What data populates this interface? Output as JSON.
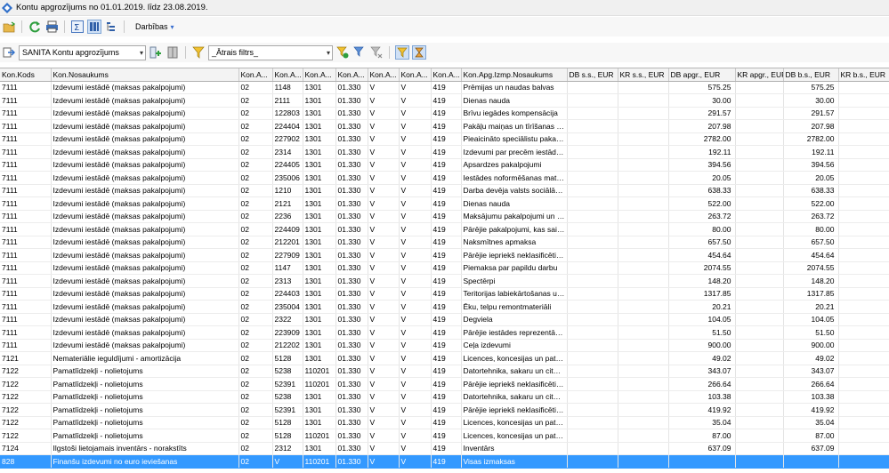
{
  "window": {
    "title": "Kontu apgrozījums no 01.01.2019. līdz 23.08.2019."
  },
  "toolbar1": {
    "actions_label": "Darbības"
  },
  "toolbar2": {
    "account_combo": "SANITA Kontu apgrozījums",
    "filter_combo": "_Ātrais filtrs_"
  },
  "grid": {
    "columns": [
      "Kon.Kods",
      "Kon.Nosaukums",
      "Kon.A...",
      "Kon.A...",
      "Kon.A...",
      "Kon.A...",
      "Kon.A...",
      "Kon.A...",
      "Kon.A...",
      "Kon.Apg.Izmp.Nosaukums",
      "DB s.s., EUR",
      "KR s.s., EUR",
      "DB apgr., EUR",
      "KR apgr., EUR",
      "DB b.s., EUR",
      "KR b.s., EUR"
    ],
    "rows": [
      [
        "7111",
        "Izdevumi iestādē (maksas pakalpojumi)",
        "02",
        "1148",
        "1301",
        "01.330",
        "V",
        "V",
        "419",
        "Prēmijas un naudas balvas",
        "",
        "",
        "575.25",
        "",
        "575.25",
        ""
      ],
      [
        "7111",
        "Izdevumi iestādē (maksas pakalpojumi)",
        "02",
        "2111",
        "1301",
        "01.330",
        "V",
        "V",
        "419",
        "Dienas nauda",
        "",
        "",
        "30.00",
        "",
        "30.00",
        ""
      ],
      [
        "7111",
        "Izdevumi iestādē (maksas pakalpojumi)",
        "02",
        "122803",
        "1301",
        "01.330",
        "V",
        "V",
        "419",
        "Brīvu iegādes kompensācija",
        "",
        "",
        "291.57",
        "",
        "291.57",
        ""
      ],
      [
        "7111",
        "Izdevumi iestādē (maksas pakalpojumi)",
        "02",
        "224404",
        "1301",
        "01.330",
        "V",
        "V",
        "419",
        "Pakāļu maiņas un tīrīšanas izm...",
        "",
        "",
        "207.98",
        "",
        "207.98",
        ""
      ],
      [
        "7111",
        "Izdevumi iestādē (maksas pakalpojumi)",
        "02",
        "227902",
        "1301",
        "01.330",
        "V",
        "V",
        "419",
        "Pieaicināto speciālistu pakalpoj...",
        "",
        "",
        "2782.00",
        "",
        "2782.00",
        ""
      ],
      [
        "7111",
        "Izdevumi iestādē (maksas pakalpojumi)",
        "02",
        "2314",
        "1301",
        "01.330",
        "V",
        "V",
        "419",
        "Izdevumi par precēm iestādes ...",
        "",
        "",
        "192.11",
        "",
        "192.11",
        ""
      ],
      [
        "7111",
        "Izdevumi iestādē (maksas pakalpojumi)",
        "02",
        "224405",
        "1301",
        "01.330",
        "V",
        "V",
        "419",
        "Apsardzes pakalpojumi",
        "",
        "",
        "394.56",
        "",
        "394.56",
        ""
      ],
      [
        "7111",
        "Izdevumi iestādē (maksas pakalpojumi)",
        "02",
        "235006",
        "1301",
        "01.330",
        "V",
        "V",
        "419",
        "Iestādes noformēšanas materiāli",
        "",
        "",
        "20.05",
        "",
        "20.05",
        ""
      ],
      [
        "7111",
        "Izdevumi iestādē (maksas pakalpojumi)",
        "02",
        "1210",
        "1301",
        "01.330",
        "V",
        "V",
        "419",
        "Darba devēja valsts sociālās a...",
        "",
        "",
        "638.33",
        "",
        "638.33",
        ""
      ],
      [
        "7111",
        "Izdevumi iestādē (maksas pakalpojumi)",
        "02",
        "2121",
        "1301",
        "01.330",
        "V",
        "V",
        "419",
        "Dienas nauda",
        "",
        "",
        "522.00",
        "",
        "522.00",
        ""
      ],
      [
        "7111",
        "Izdevumi iestādē (maksas pakalpojumi)",
        "02",
        "2236",
        "1301",
        "01.330",
        "V",
        "V",
        "419",
        "Maksājumu pakalpojumi un kom...",
        "",
        "",
        "263.72",
        "",
        "263.72",
        ""
      ],
      [
        "7111",
        "Izdevumi iestādē (maksas pakalpojumi)",
        "02",
        "224409",
        "1301",
        "01.330",
        "V",
        "V",
        "419",
        "Pārējie pakalpojumi, kas saistīt...",
        "",
        "",
        "80.00",
        "",
        "80.00",
        ""
      ],
      [
        "7111",
        "Izdevumi iestādē (maksas pakalpojumi)",
        "02",
        "212201",
        "1301",
        "01.330",
        "V",
        "V",
        "419",
        "Naksmītnes apmaksa",
        "",
        "",
        "657.50",
        "",
        "657.50",
        ""
      ],
      [
        "7111",
        "Izdevumi iestādē (maksas pakalpojumi)",
        "02",
        "227909",
        "1301",
        "01.330",
        "V",
        "V",
        "419",
        "Pārējie iepriekš neklasificētie p...",
        "",
        "",
        "454.64",
        "",
        "454.64",
        ""
      ],
      [
        "7111",
        "Izdevumi iestādē (maksas pakalpojumi)",
        "02",
        "1147",
        "1301",
        "01.330",
        "V",
        "V",
        "419",
        "Piemaksa par papildu darbu",
        "",
        "",
        "2074.55",
        "",
        "2074.55",
        ""
      ],
      [
        "7111",
        "Izdevumi iestādē (maksas pakalpojumi)",
        "02",
        "2313",
        "1301",
        "01.330",
        "V",
        "V",
        "419",
        "Spectērpi",
        "",
        "",
        "148.20",
        "",
        "148.20",
        ""
      ],
      [
        "7111",
        "Izdevumi iestādē (maksas pakalpojumi)",
        "02",
        "224403",
        "1301",
        "01.330",
        "V",
        "V",
        "419",
        "Teritorijas labiekārtošanas un ...",
        "",
        "",
        "1317.85",
        "",
        "1317.85",
        ""
      ],
      [
        "7111",
        "Izdevumi iestādē (maksas pakalpojumi)",
        "02",
        "235004",
        "1301",
        "01.330",
        "V",
        "V",
        "419",
        "Ēku, telpu remontmateriāli",
        "",
        "",
        "20.21",
        "",
        "20.21",
        ""
      ],
      [
        "7111",
        "Izdevumi iestādē (maksas pakalpojumi)",
        "02",
        "2322",
        "1301",
        "01.330",
        "V",
        "V",
        "419",
        "Degviela",
        "",
        "",
        "104.05",
        "",
        "104.05",
        ""
      ],
      [
        "7111",
        "Izdevumi iestādē (maksas pakalpojumi)",
        "02",
        "223909",
        "1301",
        "01.330",
        "V",
        "V",
        "419",
        "Pārējie iestādes reprezentācija...",
        "",
        "",
        "51.50",
        "",
        "51.50",
        ""
      ],
      [
        "7111",
        "Izdevumi iestādē (maksas pakalpojumi)",
        "02",
        "212202",
        "1301",
        "01.330",
        "V",
        "V",
        "419",
        "Ceļa izdevumi",
        "",
        "",
        "900.00",
        "",
        "900.00",
        ""
      ],
      [
        "7121",
        "Nemateriālie ieguldījumi - amortizācija",
        "02",
        "5128",
        "1301",
        "01.330",
        "V",
        "V",
        "419",
        "Licences, koncesijas un patenti...",
        "",
        "",
        "49.02",
        "",
        "49.02",
        ""
      ],
      [
        "7122",
        "Pamatlīdzekļi - nolietojums",
        "02",
        "5238",
        "110201",
        "01.330",
        "V",
        "V",
        "419",
        "Datortehnika, sakaru un cita bi...",
        "",
        "",
        "343.07",
        "",
        "343.07",
        ""
      ],
      [
        "7122",
        "Pamatlīdzekļi - nolietojums",
        "02",
        "52391",
        "110201",
        "01.330",
        "V",
        "V",
        "419",
        "Pārējie iepriekš neklasificētie p...",
        "",
        "",
        "266.64",
        "",
        "266.64",
        ""
      ],
      [
        "7122",
        "Pamatlīdzekļi - nolietojums",
        "02",
        "5238",
        "1301",
        "01.330",
        "V",
        "V",
        "419",
        "Datortehnika, sakaru un cita bi...",
        "",
        "",
        "103.38",
        "",
        "103.38",
        ""
      ],
      [
        "7122",
        "Pamatlīdzekļi - nolietojums",
        "02",
        "52391",
        "1301",
        "01.330",
        "V",
        "V",
        "419",
        "Pārējie iepriekš neklasificētie p...",
        "",
        "",
        "419.92",
        "",
        "419.92",
        ""
      ],
      [
        "7122",
        "Pamatlīdzekļi - nolietojums",
        "02",
        "5128",
        "1301",
        "01.330",
        "V",
        "V",
        "419",
        "Licences, koncesijas un patenti...",
        "",
        "",
        "35.04",
        "",
        "35.04",
        ""
      ],
      [
        "7122",
        "Pamatlīdzekļi - nolietojums",
        "02",
        "5128",
        "110201",
        "01.330",
        "V",
        "V",
        "419",
        "Licences, koncesijas un patenti...",
        "",
        "",
        "87.00",
        "",
        "87.00",
        ""
      ],
      [
        "7124",
        "Ilgstoši lietojamais inventārs - norakstīts",
        "02",
        "2312",
        "1301",
        "01.330",
        "V",
        "V",
        "419",
        "Inventārs",
        "",
        "",
        "637.09",
        "",
        "637.09",
        ""
      ],
      [
        "828",
        "Finanšu izdevumi no euro ieviešanas",
        "02",
        "V",
        "110201",
        "01.330",
        "V",
        "V",
        "419",
        "Visas izmaksas",
        "",
        "",
        "",
        "",
        "",
        ""
      ]
    ]
  }
}
